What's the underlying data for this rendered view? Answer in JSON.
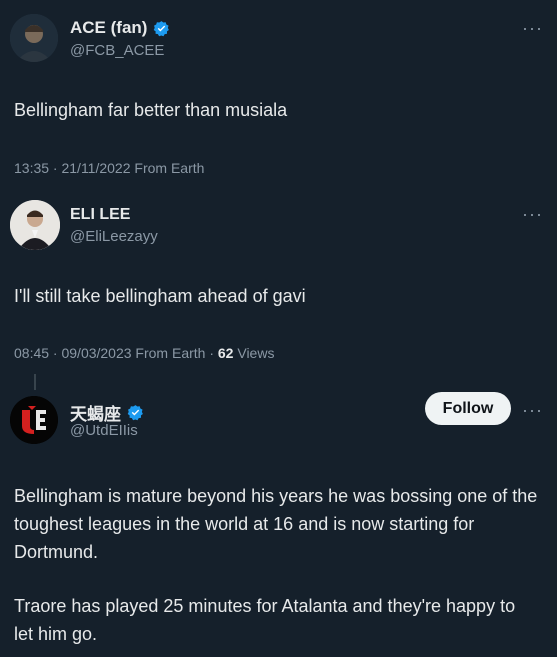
{
  "tweets": [
    {
      "name": "ACE (fan)",
      "handle": "@FCB_ACEE",
      "verified": true,
      "text": "Bellingham far better than musiala",
      "meta": "13:35 · 21/11/2022 From Earth"
    },
    {
      "name": "ELI LEE",
      "handle": "@EliLeezayy",
      "verified": false,
      "text": "I'll still take bellingham ahead of gavi",
      "meta": "08:45 · 09/03/2023 From Earth · ",
      "views_count": "62",
      "views_label": " Views"
    },
    {
      "name": "天蝎座",
      "handle": "@UtdEIIis",
      "verified": true,
      "follow_label": "Follow",
      "text_p1": "Bellingham is mature beyond his years he was bossing one of the toughest leagues in the world at 16 and is now starting for Dortmund.",
      "text_p2": "Traore has played 25 minutes for Atalanta and they're happy to let him go."
    }
  ],
  "more_glyph": "···",
  "colors": {
    "background": "#15202b",
    "verified_blue": "#1d9bf0",
    "secondary_text": "#8b98a5",
    "follow_bg": "#eff3f4"
  }
}
